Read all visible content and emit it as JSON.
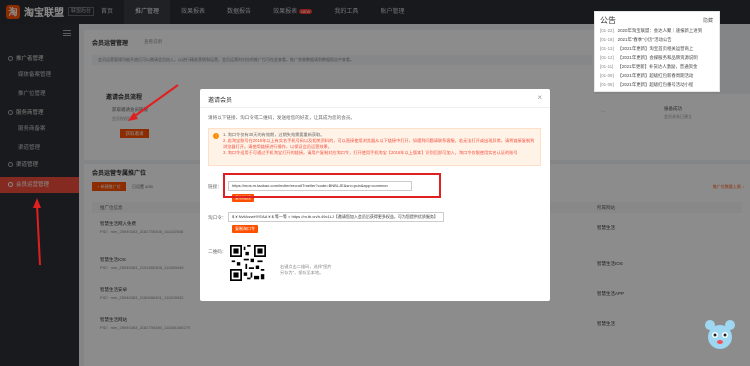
{
  "topbar": {
    "logo": "淘宝联盟",
    "logo_badge": "联盟后台",
    "nav": [
      "首页",
      "推广管理",
      "效果报表",
      "数据报告",
      "效果报表",
      "我的工具",
      "账户管理"
    ],
    "new_badge": "NEW"
  },
  "sidebar": {
    "items": [
      {
        "label": "推广者管理",
        "type": "group"
      },
      {
        "label": "媒体备案管理",
        "type": "item"
      },
      {
        "label": "推广位管理",
        "type": "item"
      },
      {
        "label": "服务商管理",
        "type": "group"
      },
      {
        "label": "服务商备案",
        "type": "item"
      },
      {
        "label": "渠道管理",
        "type": "item"
      },
      {
        "label": "渠道管理",
        "type": "group"
      },
      {
        "label": "会员运营管理",
        "type": "active"
      }
    ]
  },
  "page": {
    "section_title": "会员运营管理",
    "breadcrumb": "查看说明",
    "info_text": "会员运营管理功能开放后可以邀请会员加入，以进行精准营销和运营，会员运营时对应的推广位可在此查看，推广效果数据请到数据报告中查看。",
    "invite_flow_title": "邀请会员流程",
    "invite_flow_sub": "获取邀请会员链接",
    "invite_flow_sub2": "会员授权后",
    "get_button": "获取邀请",
    "step_right": "报备成功",
    "step_right_sub": "会员关系已建立",
    "adzone_section_title": "会员运营专属推广位",
    "add_adzone_button": "+ 新建推广位",
    "filter_label": "已设置",
    "filter_count": "4/30",
    "right_link": "推广位数量上限 ↓",
    "col_adzone": "推广位信息",
    "col_site": "所属网站",
    "col_type": "推广位类型",
    "col_action": "操作",
    "rows": [
      {
        "name": "智慧生活网入免费",
        "pid": "PID：mm_25940383_2182750308_111142508",
        "site": "智慧生活"
      },
      {
        "name": "智慧生活IOS",
        "pid": "PID：mm_25940383_2191580308_111069449",
        "site": "智慧生活IOS"
      },
      {
        "name": "智慧生活安卓",
        "pid": "PID：mm_25940383_2180650401_111009932",
        "site": "智慧生活APP"
      },
      {
        "name": "智慧生活网站",
        "pid": "PID：mm_25940383_2182750380_111081085270",
        "site": "智慧生活"
      }
    ]
  },
  "announcement": {
    "title": "公告",
    "more": "隐藏",
    "items": [
      {
        "date": "[01-22]",
        "text": "2020年淘宝联盟：会达人聚｜速报新上进到"
      },
      {
        "date": "[01-18]",
        "text": "2021年\"春季\"小历\"活动公告"
      },
      {
        "date": "[01-13]",
        "text": "【2021年更新】淘宝首页相关运营商上"
      },
      {
        "date": "[01-12]",
        "text": "【2021年更新】会媒服务和品牌资源说明"
      },
      {
        "date": "[01-11]",
        "text": "【2021年更新】补货达人激励，普通资金"
      },
      {
        "date": "[01-09]",
        "text": "【2021年更新】超级红包新春周期活动"
      },
      {
        "date": "[01-08]",
        "text": "【2021年更新】超级红包番号活动小程"
      }
    ]
  },
  "modal": {
    "title": "邀请会员",
    "close": "×",
    "desc": "请将以下链接、淘口令或二维码，发送给您的好友，让其成为您的会员。",
    "notice_1": "1. 淘口令仅有30天的有效期，过期失效需要重新获取。",
    "notice_2": "2. 若淘宝账号在2016年以上有实名手机号码以及相关资料的，可以直接使用浏览器从以下链接中打开，如遇到问题请联系客服，若无法打开或出现异常，请将链接复制到浏览器打开。请使用链接进行操作，以保证会员运营效果。",
    "notice_3": "3. 淘口令适用于可通过手机淘宝打开的链接。请用户复制对应淘口令，打开使用手机淘宝【2016年以上版本】识别后即可加入，淘口令仅限使用实名认证的账号",
    "link_label": "链接：",
    "link_value": "https://mos.m.taobao.com/inviter/recruitTmeller?code=BNBLJE&src=pub&app=common",
    "copy_link_button": "复制链接",
    "tpwd_label": "淘口令：",
    "tpwd_value": "$ ¥ NvMvzwHYEAA ¥ $ 等一等 > https //m.tb.cn/h.49c1LJ【邀请您加入会员后获得更多权益，可为您提供优质服务】",
    "copy_tpwd_button": "复制淘口令",
    "qr_label": "二维码：",
    "qr_hint_1": "右键点击二维码，选择\"图片",
    "qr_hint_2": "另存为\"，保存至本地。"
  },
  "colors": {
    "accent": "#ff5000",
    "sidebar_active": "#f14e3b",
    "topbar_bg": "#2d2e33",
    "highlight_red": "#e02020"
  }
}
